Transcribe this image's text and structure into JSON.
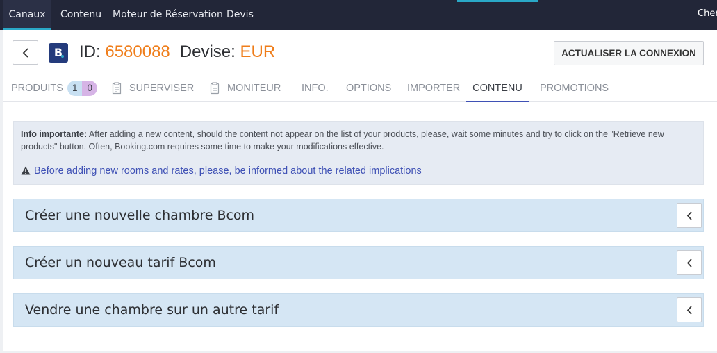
{
  "topnav": {
    "items": [
      {
        "label": "Canaux",
        "active": true
      },
      {
        "label": "Contenu",
        "active": false
      },
      {
        "label": "Moteur de Réservation",
        "active": false
      },
      {
        "label": "Devis",
        "active": false
      }
    ],
    "search_fragment": "Cher"
  },
  "header": {
    "logo_letter": "B",
    "id_label": "ID:",
    "id_value": "6580088",
    "currency_label": "Devise:",
    "currency_value": "EUR",
    "refresh_label": "ACTUALISER LA CONNEXION"
  },
  "tabs": {
    "produits": {
      "label": "PRODUITS",
      "badge_a": "1",
      "badge_b": "0"
    },
    "superviser": {
      "label": "SUPERVISER",
      "icon": "clipboard-list-icon"
    },
    "moniteur": {
      "label": "MONITEUR",
      "icon": "clipboard-icon"
    },
    "info": {
      "label": "INFO."
    },
    "options": {
      "label": "OPTIONS"
    },
    "importer": {
      "label": "IMPORTER"
    },
    "contenu": {
      "label": "CONTENU",
      "active": true
    },
    "promotions": {
      "label": "PROMOTIONS"
    }
  },
  "info_box": {
    "bold_label": "Info importante:",
    "text": " After adding a new content, should the content not appear on the list of your products, please, wait some minutes and try to click on the \"Retrieve new products\" button. Often, Booking.com requires some time to make your modifications effective.",
    "link_text": "Before adding new rooms and rates, please, be informed about the related implications"
  },
  "panels": [
    {
      "title": "Créer une nouvelle chambre Bcom"
    },
    {
      "title": "Créer un nouveau tarif Bcom"
    },
    {
      "title": "Vendre une chambre sur un autre tarif"
    }
  ],
  "colors": {
    "topnav_bg": "#222638",
    "accent_cyan": "#2aa8c7",
    "orange_value": "#ef7d1a",
    "link_blue": "#3f51b5",
    "panel_bg": "#d5e6f4",
    "info_bg": "#e6ebf3"
  }
}
